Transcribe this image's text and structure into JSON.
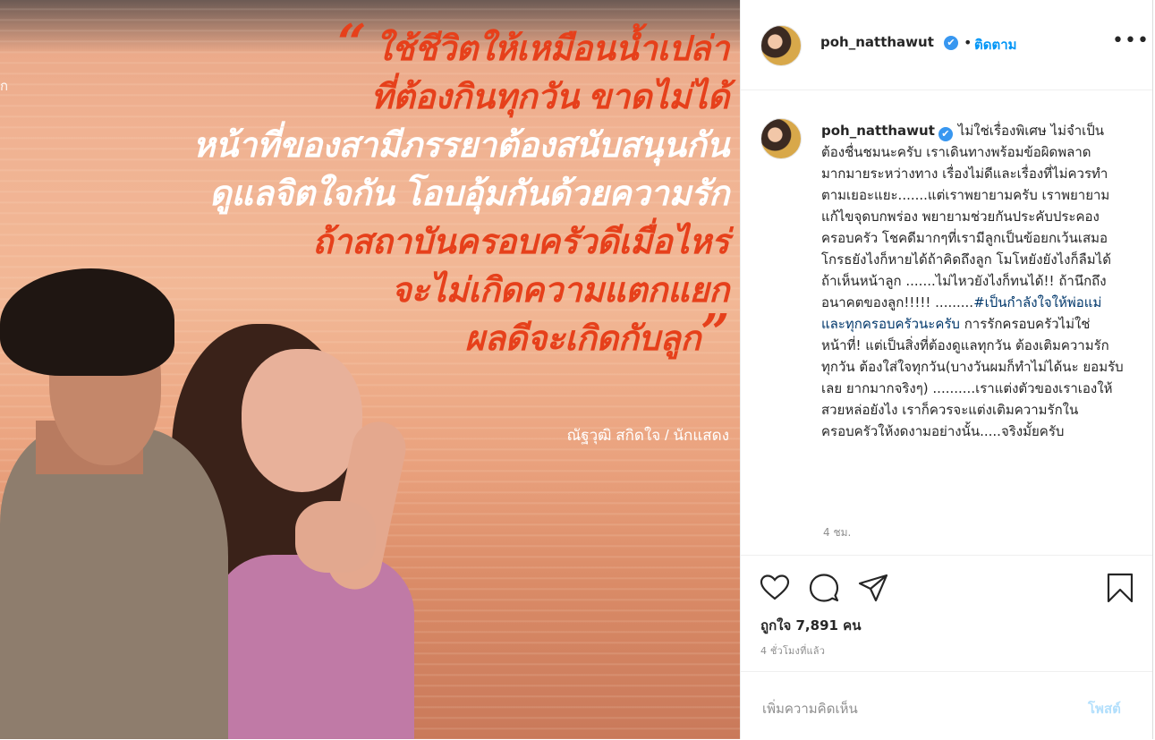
{
  "image": {
    "side_letter": "ก",
    "quote_lines": [
      {
        "text": "ใช้ชีวิตให้เหมือนน้ำเปล่า",
        "color": "orange"
      },
      {
        "text": "ที่ต้องกินทุกวัน ขาดไม่ได้",
        "color": "orange"
      },
      {
        "text": "หน้าที่ของสามีภรรยาต้องสนับสนุนกัน",
        "color": "white"
      },
      {
        "text": "ดูแลจิตใจกัน โอบอุ้มกันด้วยความรัก",
        "color": "white"
      },
      {
        "text": "ถ้าสถาบันครอบครัวดีเมื่อไหร่",
        "color": "orange"
      },
      {
        "text": "จะไม่เกิดความแตกแยก",
        "color": "orange"
      },
      {
        "text": "ผลดีจะเกิดกับลูก",
        "color": "orange"
      }
    ],
    "open_quote": "“",
    "close_quote": "”",
    "credit": "ณัฐวุฒิ สกิดใจ / นักแสดง",
    "colors": {
      "orange": "#e6401b",
      "white": "#ffffff"
    }
  },
  "header": {
    "username": "poh_natthawut",
    "verified_icon": "✔",
    "separator": "•",
    "follow_label": "ติดตาม",
    "more_icon": "•••"
  },
  "caption": {
    "username": "poh_natthawut",
    "text_part1": "ไม่ใช่เรื่องพิเศษ ไม่จำเป็นต้องชื่นชมนะครับ เราเดินทางพร้อมข้อผิดพลาดมากมายระหว่างทาง เรื่องไม่ดีและเรื่องที่ไม่ควรทำตามเยอะแยะ.......แต่เราพยายามครับ เราพยายามแก้ไขจุดบกพร่อง พยายามช่วยกันประคับประคองครอบครัว โชคดีมากๆที่เรามีลูกเป็นข้อยกเว้นเสมอ โกรธยังไงก็หายได้ถ้าคิดถึงลูก โมโหยังยังไงก็ลืมได้ถ้าเห็นหน้าลูก .......ไม่ไหวยังไงก็ทนได้!! ถ้านึกถึงอนาคตของลูก!!!!! .........",
    "hashtag": "#เป็นกำลังใจให้พ่อแม่และทุกครอบครัวนะครับ",
    "text_part2": " การรักครอบครัวไม่ใช่หน้าที่! แต่เป็นสิ่งที่ต้องดูแลทุกวัน ต้องเติมความรักทุกวัน ต้องใส่ใจทุกวัน(บางวันผมก็ทำไม่ได้นะ ยอมรับเลย ยากมากจริงๆ) ..........เราแต่งตัวของเราเองให้สวยหล่อยังไง เราก็ควรจะแต่งเติมความรักในครอบครัวให้งดงามอย่างนั้น.....จริงมั้ยครับ",
    "time": "4 ชม."
  },
  "actions": {
    "icons": [
      "heart-icon",
      "comment-icon",
      "share-icon",
      "bookmark-icon"
    ],
    "likes": "ถูกใจ 7,891 คน",
    "post_time": "4 ชั่วโมงที่แล้ว"
  },
  "comment": {
    "placeholder": "เพิ่มความคิดเห็น",
    "post_label": "โพสต์"
  }
}
